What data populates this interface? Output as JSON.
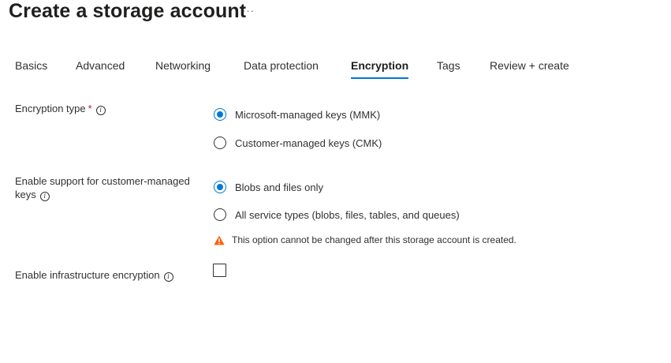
{
  "header": {
    "title": "Create a storage account",
    "more_label": "···"
  },
  "tabs": [
    {
      "label": "Basics",
      "active": false
    },
    {
      "label": "Advanced",
      "active": false
    },
    {
      "label": "Networking",
      "active": false
    },
    {
      "label": "Data protection",
      "active": false
    },
    {
      "label": "Encryption",
      "active": true
    },
    {
      "label": "Tags",
      "active": false
    },
    {
      "label": "Review + create",
      "active": false
    }
  ],
  "encryption_type": {
    "label": "Encryption type",
    "required_marker": "*",
    "options": [
      {
        "label": "Microsoft-managed keys (MMK)",
        "selected": true
      },
      {
        "label": "Customer-managed keys (CMK)",
        "selected": false
      }
    ]
  },
  "cmk_support": {
    "label_line1": "Enable support for customer-managed",
    "label_line2": "keys",
    "options": [
      {
        "label": "Blobs and files only",
        "selected": true
      },
      {
        "label": "All service types (blobs, files, tables, and queues)",
        "selected": false
      }
    ],
    "warning_text": "This option cannot be changed after this storage account is created."
  },
  "infrastructure_encryption": {
    "label": "Enable infrastructure encryption",
    "checked": false
  },
  "colors": {
    "accent": "#0078d4",
    "warning": "#f7630c",
    "required": "#a4262c"
  },
  "icons": {
    "info": "info-icon",
    "warning": "warning-icon",
    "more": "more-icon"
  }
}
